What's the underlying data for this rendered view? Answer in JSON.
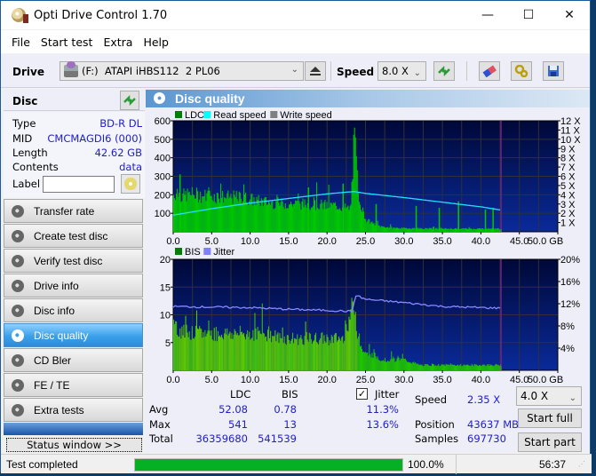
{
  "window": {
    "title": "Opti Drive Control 1.70",
    "controls": [
      "minimize",
      "maximize",
      "close"
    ]
  },
  "menu": [
    "File",
    "Start test",
    "Extra",
    "Help"
  ],
  "toolbar": {
    "drive_label": "Drive",
    "drive_value": "(F:)  ATAPI iHBS112  2 PL06",
    "speed_label": "Speed",
    "speed_value": "8.0 X",
    "icons": [
      "eject-icon",
      "refresh-icon",
      "erase-icon",
      "settings-icon",
      "save-icon"
    ]
  },
  "disc": {
    "header": "Disc",
    "rows": [
      {
        "label": "Type",
        "value": "BD-R DL"
      },
      {
        "label": "MID",
        "value": "CMCMAGDI6 (000)"
      },
      {
        "label": "Length",
        "value": "42.62 GB"
      },
      {
        "label": "Contents",
        "value": "data"
      }
    ],
    "label_field": {
      "label": "Label",
      "value": ""
    }
  },
  "nav": {
    "items": [
      {
        "label": "Transfer rate",
        "active": false
      },
      {
        "label": "Create test disc",
        "active": false
      },
      {
        "label": "Verify test disc",
        "active": false
      },
      {
        "label": "Drive info",
        "active": false
      },
      {
        "label": "Disc info",
        "active": false
      },
      {
        "label": "Disc quality",
        "active": true
      },
      {
        "label": "CD Bler",
        "active": false
      },
      {
        "label": "FE / TE",
        "active": false
      },
      {
        "label": "Extra tests",
        "active": false
      }
    ],
    "status_window": "Status window >>"
  },
  "panel": {
    "title": "Disc quality"
  },
  "chart_data": [
    {
      "type": "bar",
      "title": "LDC / Read speed",
      "legend": [
        "LDC",
        "Read speed",
        "Write speed"
      ],
      "legend_colors": {
        "LDC": "#008000",
        "Read speed": "#00ffff",
        "Write speed": "#808080"
      },
      "legend_position": "top-left",
      "xlabel": "GB",
      "xlim": [
        0,
        50
      ],
      "x_ticks": [
        "0.0",
        "5.0",
        "10.0",
        "15.0",
        "20.0",
        "25.0",
        "30.0",
        "35.0",
        "40.0",
        "45.0",
        "50.0 GB"
      ],
      "ylim_left": [
        0,
        600
      ],
      "y_ticks_left": [
        "100",
        "200",
        "300",
        "400",
        "500",
        "600"
      ],
      "ylim_right": [
        0,
        12
      ],
      "y_ticks_right": [
        "1 X",
        "2 X",
        "3 X",
        "4 X",
        "5 X",
        "6 X",
        "7 X",
        "8 X",
        "9 X",
        "10 X",
        "11 X",
        "12 X"
      ],
      "grid": true,
      "end_marker_gb": 42.62,
      "ldc_series": {
        "x": [
          0,
          0.5,
          1,
          2,
          3,
          4,
          5,
          6,
          7,
          8,
          9,
          10,
          11,
          12,
          13,
          14,
          15,
          16,
          17,
          18,
          19,
          20,
          21,
          22,
          23,
          23.5,
          23.7,
          24,
          24.5,
          25,
          26,
          27,
          28,
          29,
          30,
          31,
          32,
          33,
          34,
          35,
          36,
          37,
          38,
          39,
          40,
          41,
          42,
          42.6
        ],
        "values": [
          210,
          230,
          200,
          215,
          210,
          205,
          205,
          200,
          195,
          195,
          195,
          185,
          175,
          170,
          165,
          160,
          160,
          160,
          158,
          155,
          155,
          150,
          150,
          140,
          130,
          541,
          420,
          230,
          130,
          70,
          45,
          30,
          25,
          22,
          20,
          20,
          20,
          18,
          18,
          18,
          18,
          18,
          18,
          18,
          18,
          18,
          18,
          18
        ]
      },
      "ldc_spikes": [
        {
          "x": 0.8,
          "value": 310
        },
        {
          "x": 17.5,
          "value": 240
        },
        {
          "x": 22.0,
          "value": 260
        },
        {
          "x": 26.3,
          "value": 150
        },
        {
          "x": 31.5,
          "value": 140
        },
        {
          "x": 34.5,
          "value": 130
        },
        {
          "x": 37.0,
          "value": 165
        },
        {
          "x": 40.5,
          "value": 120
        },
        {
          "x": 41.5,
          "value": 130
        }
      ],
      "read_speed": {
        "x": [
          0,
          5,
          10,
          15,
          20,
          23.5,
          25,
          30,
          35,
          40,
          42.6
        ],
        "values": [
          1.8,
          2.5,
          3.1,
          3.6,
          4.1,
          4.35,
          4.15,
          3.7,
          3.2,
          2.7,
          2.35
        ]
      }
    },
    {
      "type": "bar",
      "title": "BIS / Jitter",
      "legend": [
        "BIS",
        "Jitter"
      ],
      "legend_colors": {
        "BIS": "#008000",
        "Jitter": "#8080ff"
      },
      "legend_position": "top-left",
      "xlabel": "GB",
      "xlim": [
        0,
        50
      ],
      "x_ticks": [
        "0.0",
        "5.0",
        "10.0",
        "15.0",
        "20.0",
        "25.0",
        "30.0",
        "35.0",
        "40.0",
        "45.0",
        "50.0 GB"
      ],
      "ylim_left": [
        0,
        20
      ],
      "y_ticks_left": [
        "5",
        "10",
        "15",
        "20"
      ],
      "ylim_right": [
        0,
        20
      ],
      "y_ticks_right": [
        "4%",
        "8%",
        "12%",
        "16%",
        "20%"
      ],
      "grid": true,
      "end_marker_gb": 42.62,
      "bis_series": {
        "x": [
          0,
          2,
          4,
          6,
          8,
          10,
          12,
          14,
          16,
          18,
          20,
          22,
          23.5,
          24,
          25,
          26,
          27,
          28,
          30,
          32,
          34,
          36,
          38,
          40,
          42.6
        ],
        "values": [
          8,
          7,
          7,
          7,
          7,
          7,
          7,
          6,
          6,
          6,
          6,
          6,
          13,
          5,
          3,
          3,
          2,
          2,
          2,
          1,
          1,
          1,
          1,
          1,
          1
        ]
      },
      "jitter": {
        "x": [
          0,
          5,
          10,
          15,
          20,
          23.4,
          23.6,
          25,
          30,
          35,
          40,
          42.6
        ],
        "values": [
          11.5,
          11.4,
          11.3,
          11.0,
          10.8,
          10.6,
          13.6,
          12.8,
          12.2,
          11.5,
          11.3,
          11.2
        ]
      }
    }
  ],
  "stats": {
    "col_headers": [
      "LDC",
      "BIS"
    ],
    "jitter_label": "Jitter",
    "jitter_checked": true,
    "rows": [
      {
        "label": "Avg",
        "ldc": "52.08",
        "bis": "0.78",
        "jitter": "11.3%"
      },
      {
        "label": "Max",
        "ldc": "541",
        "bis": "13",
        "jitter": "13.6%"
      },
      {
        "label": "Total",
        "ldc": "36359680",
        "bis": "541539",
        "jitter": ""
      }
    ],
    "speed_label": "Speed",
    "speed_value": "2.35 X",
    "position_label": "Position",
    "position_value": "43637 MB",
    "samples_label": "Samples",
    "samples_value": "697730",
    "test_speed": "4.0 X",
    "start_full": "Start full",
    "start_part": "Start part"
  },
  "statusbar": {
    "text": "Test completed",
    "progress": 100.0,
    "progress_label": "100.0%",
    "time": "56:37"
  }
}
